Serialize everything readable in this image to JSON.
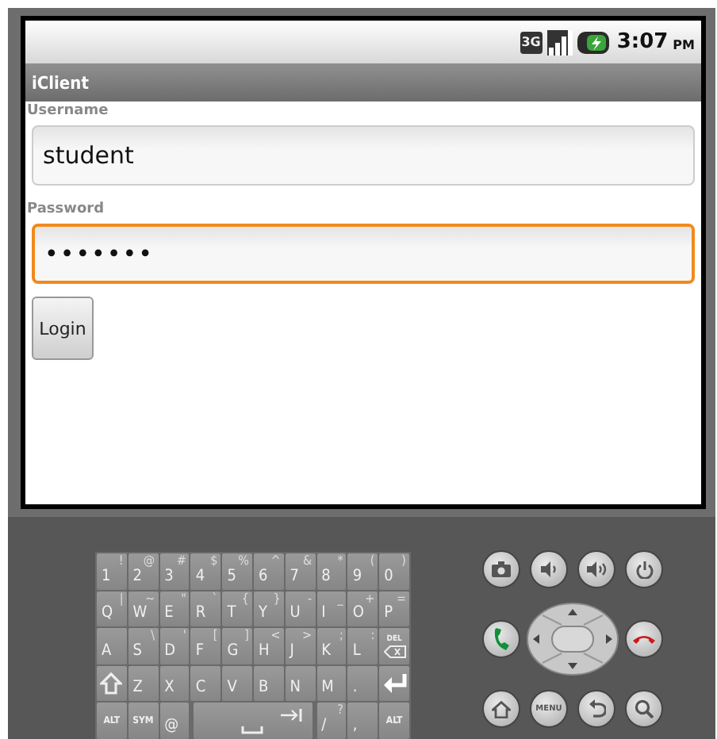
{
  "status_bar": {
    "network": "3G",
    "time": "3:07",
    "ampm": "PM"
  },
  "title_bar": {
    "title": "iClient"
  },
  "form": {
    "fields": [
      {
        "label": "Username",
        "value": "student",
        "focused": false
      },
      {
        "label": "Password",
        "value": "•••••••",
        "focused": true
      }
    ],
    "button": "Login"
  },
  "keyboard": {
    "rows": [
      [
        {
          "kind": "char",
          "label": "1",
          "alt": "!"
        },
        {
          "kind": "char",
          "label": "2",
          "alt": "@"
        },
        {
          "kind": "char",
          "label": "3",
          "alt": "#"
        },
        {
          "kind": "char",
          "label": "4",
          "alt": "$"
        },
        {
          "kind": "char",
          "label": "5",
          "alt": "%"
        },
        {
          "kind": "char",
          "label": "6",
          "alt": "^"
        },
        {
          "kind": "char",
          "label": "7",
          "alt": "&"
        },
        {
          "kind": "char",
          "label": "8",
          "alt": "*"
        },
        {
          "kind": "char",
          "label": "9",
          "alt": "("
        },
        {
          "kind": "char",
          "label": "0",
          "alt": ")"
        }
      ],
      [
        {
          "kind": "char",
          "label": "Q",
          "alt": "|"
        },
        {
          "kind": "char",
          "label": "W",
          "alt": "~"
        },
        {
          "kind": "char",
          "label": "E",
          "alt": "\""
        },
        {
          "kind": "char",
          "label": "R",
          "alt": "`"
        },
        {
          "kind": "char",
          "label": "T",
          "alt": "{"
        },
        {
          "kind": "char",
          "label": "Y",
          "alt": "}"
        },
        {
          "kind": "char",
          "label": "U",
          "alt": "-"
        },
        {
          "kind": "char",
          "label": "I",
          "alt": "_"
        },
        {
          "kind": "char",
          "label": "O",
          "alt": "+"
        },
        {
          "kind": "char",
          "label": "P",
          "alt": "="
        }
      ],
      [
        {
          "kind": "char",
          "label": "A"
        },
        {
          "kind": "char",
          "label": "S",
          "alt": "\\"
        },
        {
          "kind": "char",
          "label": "D",
          "alt": "'"
        },
        {
          "kind": "char",
          "label": "F",
          "alt": "["
        },
        {
          "kind": "char",
          "label": "G",
          "alt": "]"
        },
        {
          "kind": "char",
          "label": "H",
          "alt": "<"
        },
        {
          "kind": "char",
          "label": "J",
          "alt": ">"
        },
        {
          "kind": "char",
          "label": "K",
          "alt": ";"
        },
        {
          "kind": "char",
          "label": "L",
          "alt": ":"
        },
        {
          "kind": "delete",
          "label": "DEL"
        }
      ],
      [
        {
          "kind": "shift"
        },
        {
          "kind": "char",
          "label": "Z"
        },
        {
          "kind": "char",
          "label": "X"
        },
        {
          "kind": "char",
          "label": "C"
        },
        {
          "kind": "char",
          "label": "V"
        },
        {
          "kind": "char",
          "label": "B"
        },
        {
          "kind": "char",
          "label": "N"
        },
        {
          "kind": "char",
          "label": "M"
        },
        {
          "kind": "char",
          "label": "."
        },
        {
          "kind": "enter"
        }
      ]
    ],
    "bottom_row": [
      {
        "kind": "small",
        "label": "ALT"
      },
      {
        "kind": "small",
        "label": "SYM"
      },
      {
        "kind": "char",
        "label": "@"
      },
      {
        "kind": "space"
      },
      {
        "kind": "char",
        "label": "/",
        "alt": "?"
      },
      {
        "kind": "char",
        "label": ","
      },
      {
        "kind": "small",
        "label": "ALT"
      }
    ]
  },
  "hardware_buttons": [
    {
      "kind": "camera"
    },
    {
      "kind": "volume-down"
    },
    {
      "kind": "volume-up"
    },
    {
      "kind": "power"
    },
    {
      "kind": "call"
    },
    {
      "kind": "dpad"
    },
    {
      "kind": "end-call"
    },
    {
      "kind": "home"
    },
    {
      "kind": "menu",
      "label": "MENU"
    },
    {
      "kind": "back"
    },
    {
      "kind": "search"
    }
  ]
}
